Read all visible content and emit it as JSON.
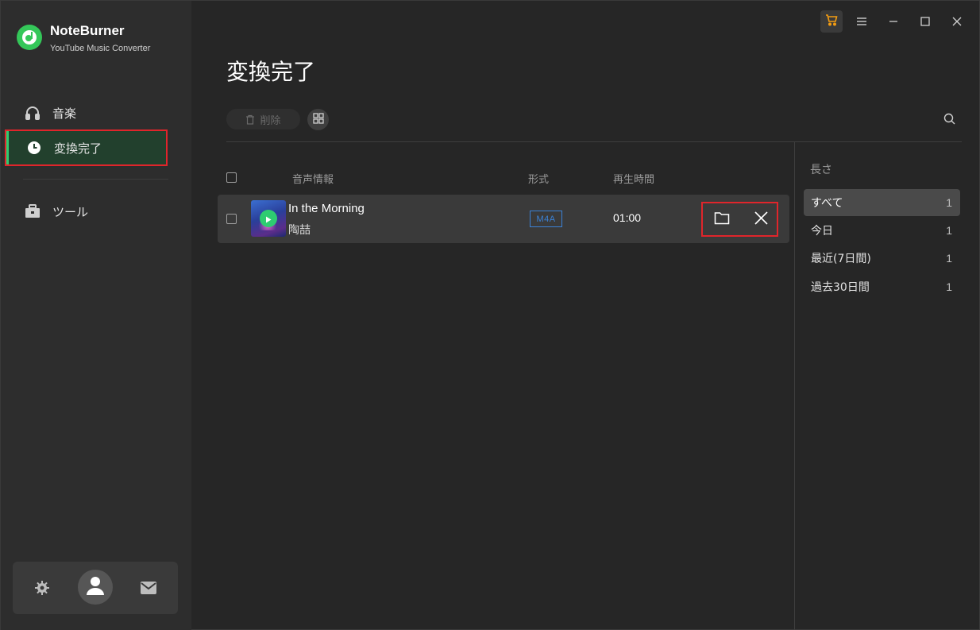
{
  "app": {
    "name": "NoteBurner",
    "subtitle": "YouTube Music Converter"
  },
  "sidebar": {
    "items": [
      {
        "label": "音楽",
        "icon": "headphones-icon"
      },
      {
        "label": "変換完了",
        "icon": "clock-icon",
        "active": true
      },
      {
        "label": "ツール",
        "icon": "toolbox-icon"
      }
    ],
    "bottom": {
      "settings_icon": "gear-icon",
      "avatar_icon": "user-icon",
      "mail_icon": "mail-icon"
    }
  },
  "titlebar": {
    "icons": [
      "cart-icon",
      "menu-icon",
      "minimize-icon",
      "maximize-icon",
      "close-icon"
    ],
    "cart_color": "#f39c12"
  },
  "main": {
    "title": "変換完了",
    "delete_label": "削除",
    "columns": {
      "info": "音声情報",
      "format": "形式",
      "duration": "再生時間"
    },
    "rows": [
      {
        "title": "In the Morning",
        "artist": "陶喆",
        "format": "M4A",
        "duration": "01:00"
      }
    ]
  },
  "filter": {
    "title": "長さ",
    "items": [
      {
        "label": "すべて",
        "count": "1",
        "active": true
      },
      {
        "label": "今日",
        "count": "1"
      },
      {
        "label": "最近(7日間)",
        "count": "1"
      },
      {
        "label": "過去30日間",
        "count": "1"
      }
    ]
  },
  "colors": {
    "accent_green": "#2ecc71",
    "highlight_red": "#e0252b",
    "format_blue": "#3b82d6"
  }
}
